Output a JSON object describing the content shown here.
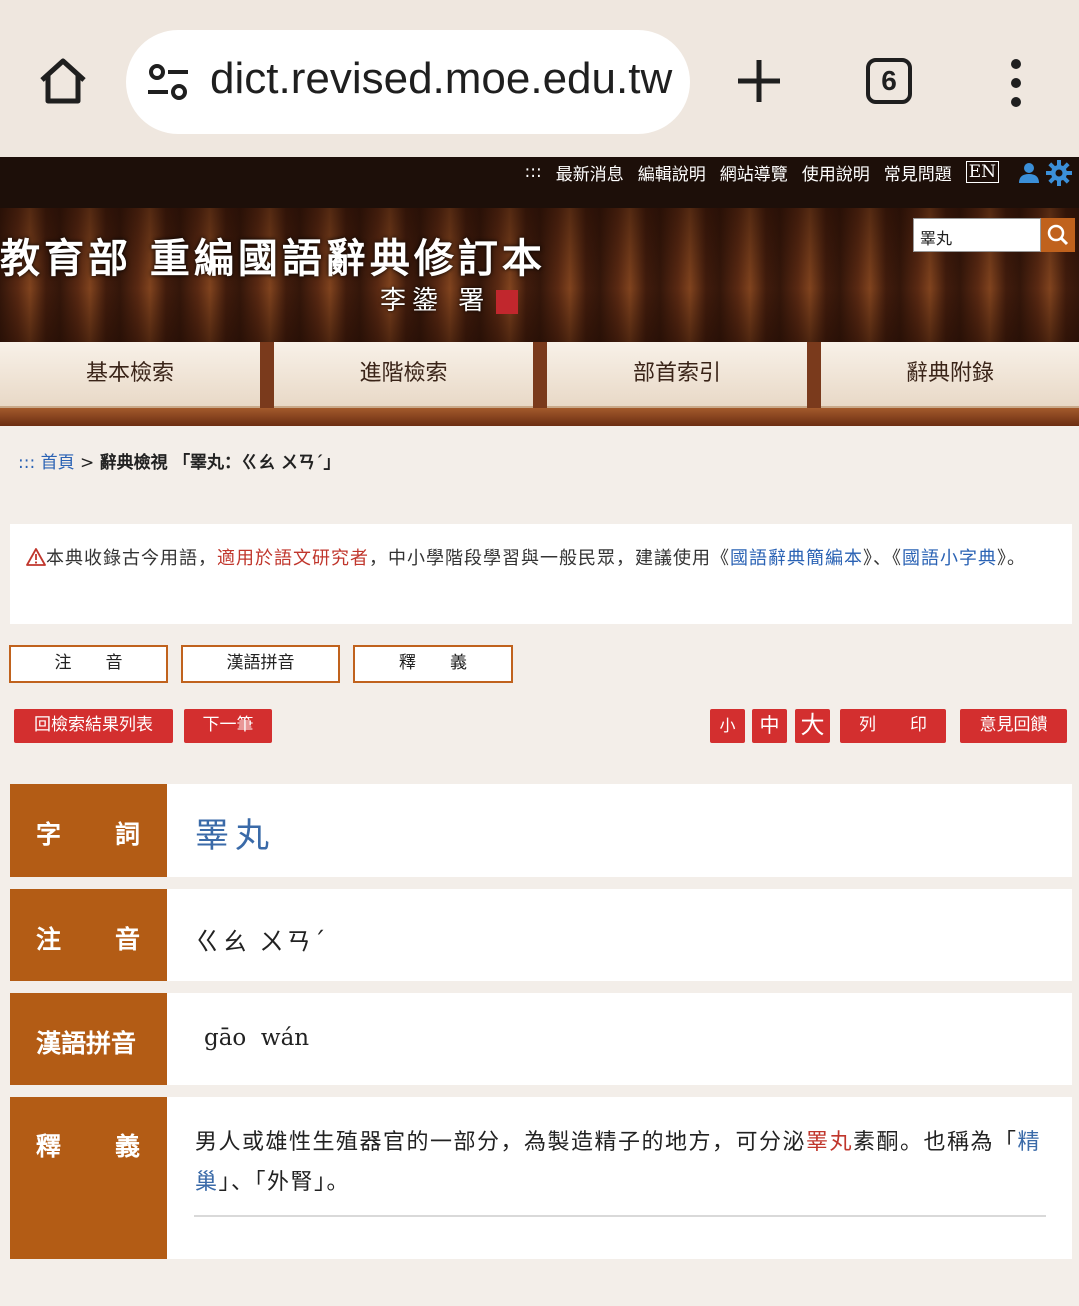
{
  "browser": {
    "url": "dict.revised.moe.edu.tw",
    "tab_count": "6"
  },
  "topbar": {
    "links": [
      "最新消息",
      "編輯說明",
      "網站導覽",
      "使用說明",
      "常見問題"
    ],
    "accesskey": ":::",
    "lang": "EN"
  },
  "banner": {
    "title": "教育部 重編國語辭典修訂本",
    "signature": "李鍌 署",
    "search_value": "睪丸"
  },
  "nav": {
    "tabs": [
      "基本檢索",
      "進階檢索",
      "部首索引",
      "辭典附錄"
    ]
  },
  "breadcrumb": {
    "accesskey": ":::",
    "home": "首頁",
    "sep": ">",
    "current": "辭典檢視",
    "query": "「睪丸：ㄍㄠ ㄨㄢˊ」"
  },
  "notice": {
    "part1": "本典收錄古今用語，",
    "part2": "適用於語文研究者",
    "part3": "，中小學階段學習與一般民眾，建議使用《",
    "link1": "國語辭典簡編本",
    "part4": "》、《",
    "link2": "國語小字典",
    "part5": "》。"
  },
  "field_tabs": [
    "注　　音",
    "漢語拼音",
    "釋　　義"
  ],
  "actions": {
    "back": "回檢索結果列表",
    "next": "下一筆",
    "small": "小",
    "medium": "中",
    "large": "大",
    "print": "列　　印",
    "feedback": "意見回饋"
  },
  "entry": {
    "word_label_1": "字",
    "word_label_2": "詞",
    "word": "睪丸",
    "zhuyin_label_1": "注",
    "zhuyin_label_2": "音",
    "zhuyin": "ㄍㄠ ㄨㄢˊ",
    "pinyin_label": "漢語拼音",
    "pinyin": "gāo  wán",
    "def_label_1": "釋",
    "def_label_2": "義",
    "def_part1": "男人或雄性生殖器官的一部分，為製造精子的地方，可分泌",
    "def_highlight": "睪丸",
    "def_part2": "素酮。也稱為「",
    "def_link": "精巢",
    "def_part3": "」、「外腎」。"
  },
  "colors": {
    "label_bg": "#b35c15",
    "button_red": "#d32f2f",
    "link_blue": "#2a62b4"
  }
}
